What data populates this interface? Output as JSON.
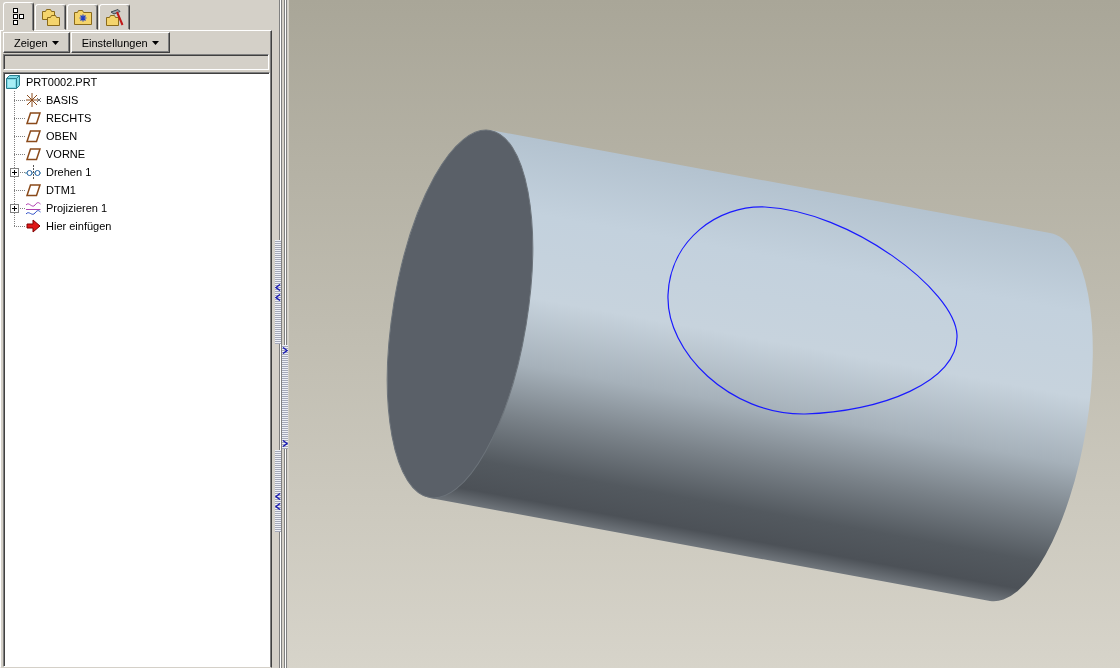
{
  "tabs": [
    {
      "kind": "tree",
      "selected": true
    },
    {
      "kind": "folders",
      "selected": false
    },
    {
      "kind": "folder-star",
      "selected": false
    },
    {
      "kind": "folder-hammer",
      "selected": false
    }
  ],
  "menu_buttons": [
    {
      "label": "Zeigen"
    },
    {
      "label": "Einstellungen"
    }
  ],
  "model_tree": {
    "label": "PRT0002.PRT",
    "kind": "part",
    "selected": false,
    "children": [
      {
        "label": "BASIS",
        "kind": "csys",
        "selected": false
      },
      {
        "label": "RECHTS",
        "kind": "plane",
        "selected": false
      },
      {
        "label": "OBEN",
        "kind": "plane",
        "selected": false
      },
      {
        "label": "VORNE",
        "kind": "plane",
        "selected": false
      },
      {
        "label": "Drehen 1",
        "kind": "revolve",
        "selected": false,
        "expanded": false
      },
      {
        "label": "DTM1",
        "kind": "plane",
        "selected": false
      },
      {
        "label": "Projizieren 1",
        "kind": "projection",
        "selected": false,
        "expanded": false
      },
      {
        "label": "Hier einfügen",
        "kind": "insert",
        "selected": false
      }
    ]
  }
}
